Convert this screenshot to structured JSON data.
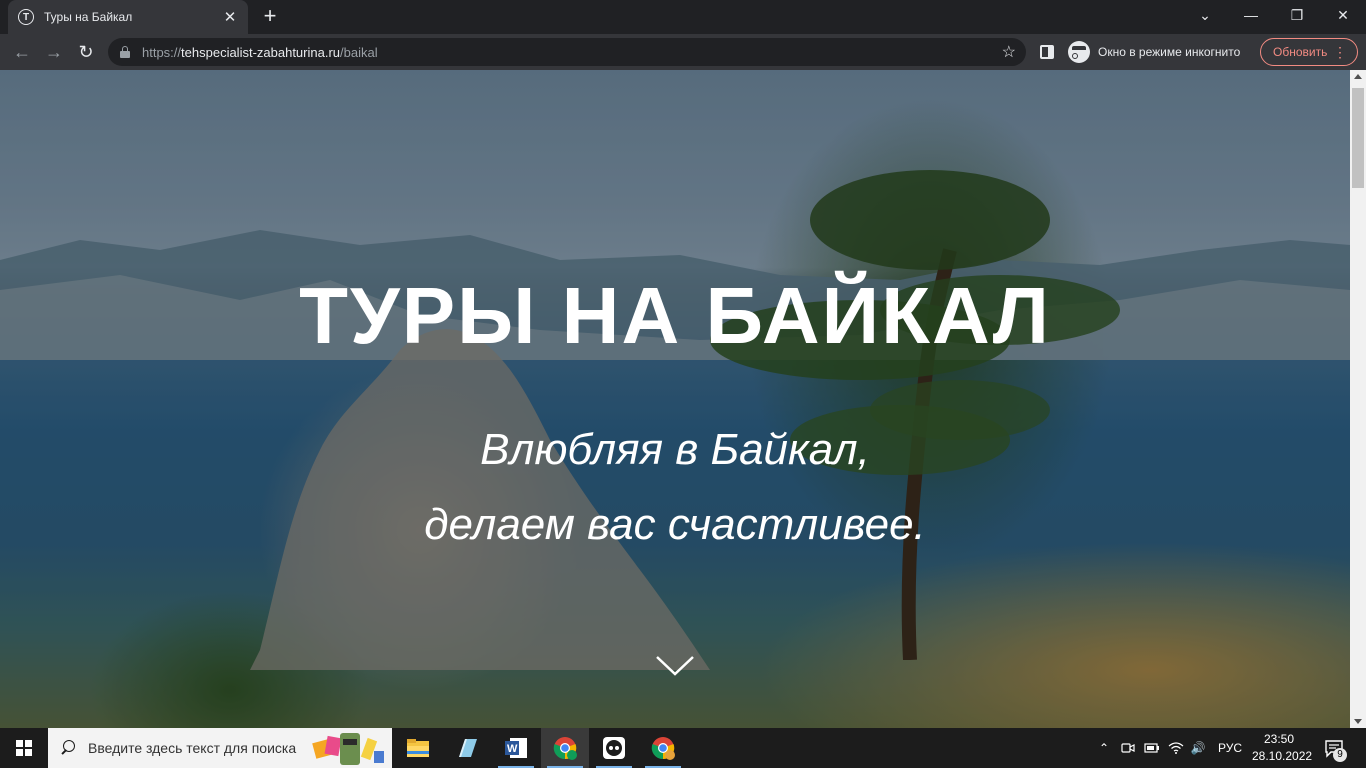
{
  "browser": {
    "tab": {
      "title": "Туры на Байкал",
      "favicon": "T"
    },
    "new_tab": "+",
    "window_controls": {
      "list": "⌄",
      "minimize": "—",
      "restore": "❐",
      "close": "✕"
    },
    "nav": {
      "back": "←",
      "forward": "→",
      "reload": "↻"
    },
    "url": {
      "scheme": "https://",
      "host": "tehspecialist-zabahturina.ru",
      "path": "/baikal"
    },
    "bookmark": "☆",
    "incognito_label": "Окно в режиме инкогнито",
    "update_label": "Обновить",
    "menu": "⋮"
  },
  "page": {
    "hero_title": "ТУРЫ НА БАЙКАЛ",
    "hero_subtitle_line1": "Влюбляя в Байкал,",
    "hero_subtitle_line2": "делаем вас счастливее."
  },
  "taskbar": {
    "search_placeholder": "Введите здесь текст для поиска",
    "language": "РУС",
    "time": "23:50",
    "date": "28.10.2022",
    "notifications_count": "9",
    "tray": {
      "chevron": "⌃",
      "speaker": "🔊"
    },
    "colors": {
      "accent": "#7ab3e8"
    }
  }
}
